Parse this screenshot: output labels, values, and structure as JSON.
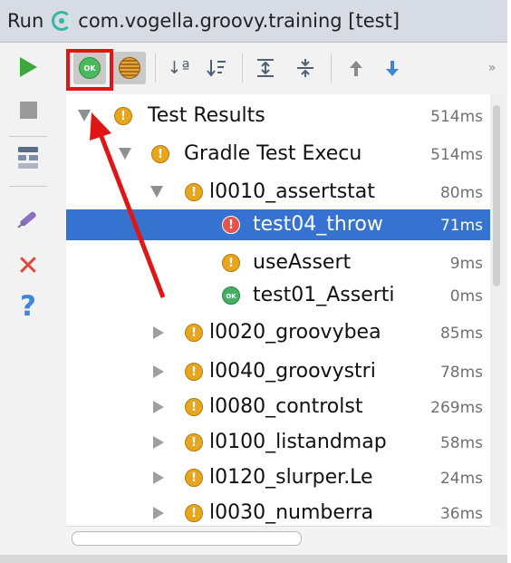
{
  "title_bar": {
    "run_label": "Run",
    "config_name": "com.vogella.groovy.training [test]"
  },
  "left_toolbar": {
    "icons": [
      "play-icon",
      "stop-icon",
      "layout-icon",
      "pin-icon",
      "close-icon",
      "help-icon"
    ],
    "close_glyph": "✕",
    "help_glyph": "?"
  },
  "top_toolbar": {
    "ok_badge": "OK",
    "sort_alpha_glyph": "↓ª",
    "more_glyph": "»",
    "highlighted_button": "show-passed-button"
  },
  "tree": {
    "rows": [
      {
        "label": "Test Results",
        "time": "514ms",
        "status": "warning",
        "expanded": true
      },
      {
        "label": "Gradle Test Execu",
        "time": "514ms",
        "status": "warning",
        "expanded": true
      },
      {
        "label": "l0010_assertstat",
        "time": "80ms",
        "status": "warning",
        "expanded": true
      },
      {
        "label": "test04_throw",
        "time": "71ms",
        "status": "error",
        "selected": true
      },
      {
        "label": "useAssert",
        "time": "9ms",
        "status": "warning"
      },
      {
        "label": "test01_Asserti",
        "time": "0ms",
        "status": "passed"
      },
      {
        "label": "l0020_groovybea",
        "time": "85ms",
        "status": "warning",
        "expanded": false
      },
      {
        "label": "l0040_groovystri",
        "time": "78ms",
        "status": "warning",
        "expanded": false
      },
      {
        "label": "l0080_controlst",
        "time": "269ms",
        "status": "warning",
        "expanded": false
      },
      {
        "label": "l0100_listandmap",
        "time": "58ms",
        "status": "warning",
        "expanded": false
      },
      {
        "label": "l0120_slurper.Le",
        "time": "24ms",
        "status": "warning",
        "expanded": false
      },
      {
        "label": "l0030_numberra",
        "time": "36ms",
        "status": "warning",
        "expanded": false
      }
    ],
    "warn_glyph": "!",
    "err_glyph": "!",
    "ok_glyph": "OK"
  },
  "colors": {
    "selection": "#3673d0",
    "annotation": "#e01616",
    "warning": "#e8a61f",
    "error": "#e5534b",
    "passed": "#44b064"
  }
}
